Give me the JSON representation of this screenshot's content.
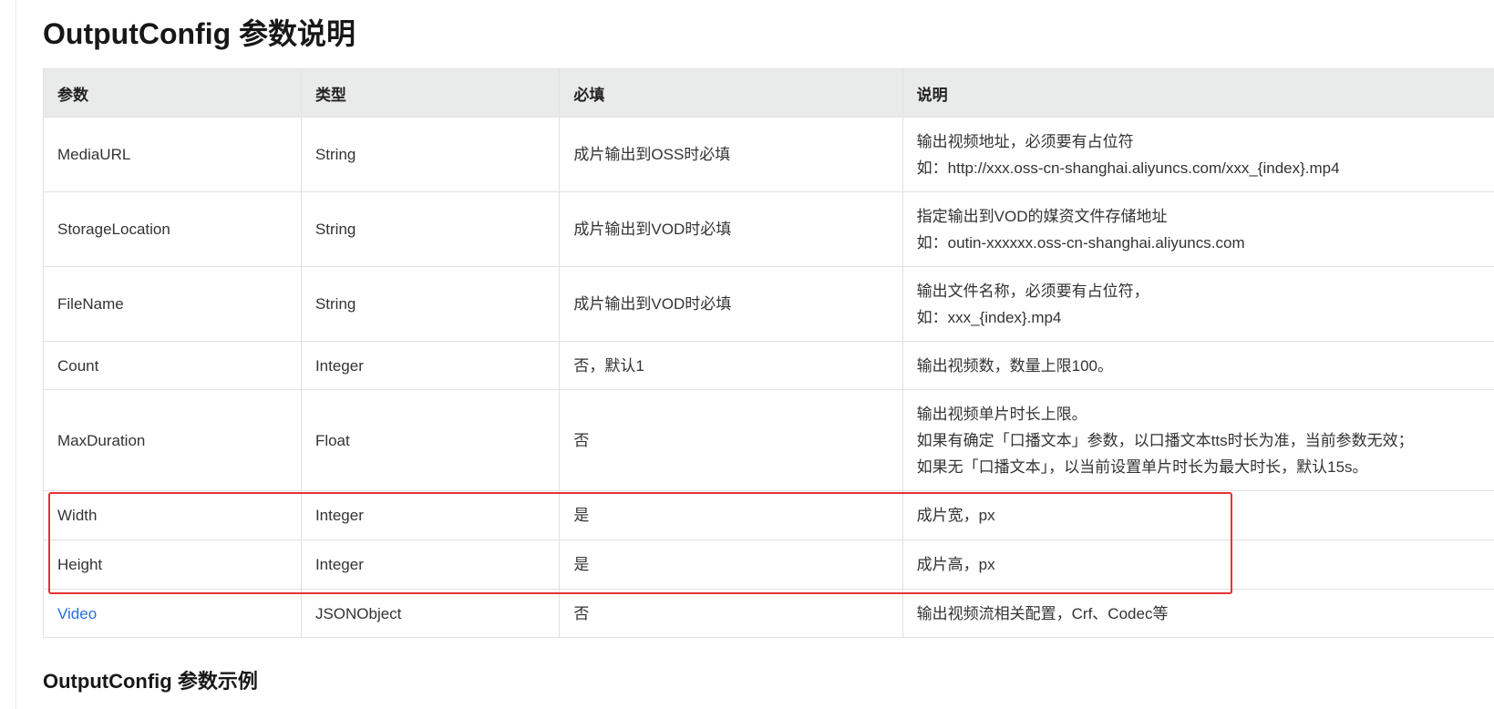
{
  "page": {
    "title": "OutputConfig 参数说明",
    "subtitle": "OutputConfig 参数示例"
  },
  "table": {
    "headers": [
      "参数",
      "类型",
      "必填",
      "说明"
    ],
    "rows": [
      {
        "name": "MediaURL",
        "type": "String",
        "required": "成片输出到OSS时必填",
        "desc": [
          "输出视频地址，必须要有占位符",
          "如：http://xxx.oss-cn-shanghai.aliyuncs.com/xxx_{index}.mp4"
        ]
      },
      {
        "name": "StorageLocation",
        "type": "String",
        "required": "成片输出到VOD时必填",
        "desc": [
          "指定输出到VOD的媒资文件存储地址",
          "如：outin-xxxxxx.oss-cn-shanghai.aliyuncs.com"
        ]
      },
      {
        "name": "FileName",
        "type": "String",
        "required": "成片输出到VOD时必填",
        "desc": [
          "输出文件名称，必须要有占位符，",
          "如：xxx_{index}.mp4"
        ]
      },
      {
        "name": "Count",
        "type": "Integer",
        "required": "否，默认1",
        "desc": [
          "输出视频数，数量上限100。"
        ]
      },
      {
        "name": "MaxDuration",
        "type": "Float",
        "required": "否",
        "desc": [
          "输出视频单片时长上限。",
          "如果有确定「口播文本」参数，以口播文本tts时长为准，当前参数无效；",
          "如果无「口播文本」，以当前设置单片时长为最大时长，默认15s。"
        ]
      },
      {
        "name": "Width",
        "type": "Integer",
        "required": "是",
        "desc": [
          "成片宽，px"
        ]
      },
      {
        "name": "Height",
        "type": "Integer",
        "required": "是",
        "desc": [
          "成片高，px"
        ]
      },
      {
        "name": "Video",
        "type": "JSONObject",
        "required": "否",
        "desc": [
          "输出视频流相关配置，Crf、Codec等"
        ]
      }
    ]
  },
  "colors": {
    "header_bg": "#e9eaea",
    "border": "#e1e1e1",
    "link": "#2a6fdb",
    "highlight": "#e63232"
  }
}
